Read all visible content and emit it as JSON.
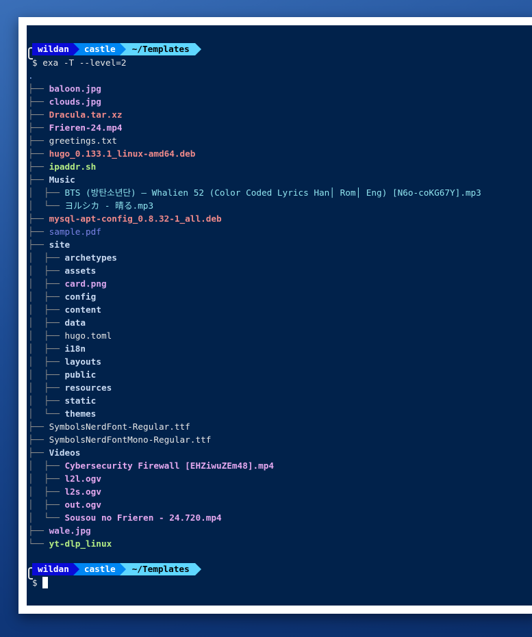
{
  "prompt": {
    "user": "wildan",
    "host": "castle",
    "dir": "~/Templates",
    "symbol": "$"
  },
  "command": "exa -T --level=2",
  "tree": [
    {
      "prefix": "",
      "name": ".",
      "type": "dot"
    },
    {
      "prefix": "├── ",
      "name": "baloon.jpg",
      "type": "img"
    },
    {
      "prefix": "├── ",
      "name": "clouds.jpg",
      "type": "img"
    },
    {
      "prefix": "├── ",
      "name": "Dracula.tar.xz",
      "type": "archive"
    },
    {
      "prefix": "├── ",
      "name": "Frieren-24.mp4",
      "type": "video"
    },
    {
      "prefix": "├── ",
      "name": "greetings.txt",
      "type": "plain"
    },
    {
      "prefix": "├── ",
      "name": "hugo_0.133.1_linux-amd64.deb",
      "type": "archive"
    },
    {
      "prefix": "├── ",
      "name": "ipaddr.sh",
      "type": "exec"
    },
    {
      "prefix": "├── ",
      "name": "Music",
      "type": "dir"
    },
    {
      "prefix": "│  ├── ",
      "name": "BTS (방탄소년단) – Whalien 52 (Color Coded Lyrics Han│ Rom│ Eng) [N6o-coKG67Y].mp3",
      "type": "audio"
    },
    {
      "prefix": "│  └── ",
      "name": "ヨルシカ - 晴る.mp3",
      "type": "audio"
    },
    {
      "prefix": "├── ",
      "name": "mysql-apt-config_0.8.32-1_all.deb",
      "type": "archive"
    },
    {
      "prefix": "├── ",
      "name": "sample.pdf",
      "type": "doc"
    },
    {
      "prefix": "├── ",
      "name": "site",
      "type": "dir"
    },
    {
      "prefix": "│  ├── ",
      "name": "archetypes",
      "type": "dir"
    },
    {
      "prefix": "│  ├── ",
      "name": "assets",
      "type": "dir"
    },
    {
      "prefix": "│  ├── ",
      "name": "card.png",
      "type": "img"
    },
    {
      "prefix": "│  ├── ",
      "name": "config",
      "type": "dir"
    },
    {
      "prefix": "│  ├── ",
      "name": "content",
      "type": "dir"
    },
    {
      "prefix": "│  ├── ",
      "name": "data",
      "type": "dir"
    },
    {
      "prefix": "│  ├── ",
      "name": "hugo.toml",
      "type": "plain"
    },
    {
      "prefix": "│  ├── ",
      "name": "i18n",
      "type": "dir"
    },
    {
      "prefix": "│  ├── ",
      "name": "layouts",
      "type": "dir"
    },
    {
      "prefix": "│  ├── ",
      "name": "public",
      "type": "dir"
    },
    {
      "prefix": "│  ├── ",
      "name": "resources",
      "type": "dir"
    },
    {
      "prefix": "│  ├── ",
      "name": "static",
      "type": "dir"
    },
    {
      "prefix": "│  └── ",
      "name": "themes",
      "type": "dir"
    },
    {
      "prefix": "├── ",
      "name": "SymbolsNerdFont-Regular.ttf",
      "type": "plain"
    },
    {
      "prefix": "├── ",
      "name": "SymbolsNerdFontMono-Regular.ttf",
      "type": "plain"
    },
    {
      "prefix": "├── ",
      "name": "Videos",
      "type": "dir"
    },
    {
      "prefix": "│  ├── ",
      "name": "Cybersecurity Firewall [EHZiwuZEm48].mp4",
      "type": "video"
    },
    {
      "prefix": "│  ├── ",
      "name": "l2l.ogv",
      "type": "video"
    },
    {
      "prefix": "│  ├── ",
      "name": "l2s.ogv",
      "type": "video"
    },
    {
      "prefix": "│  ├── ",
      "name": "out.ogv",
      "type": "video"
    },
    {
      "prefix": "│  └── ",
      "name": "Sousou no Frieren - 24.720.mp4",
      "type": "video"
    },
    {
      "prefix": "├── ",
      "name": "wale.jpg",
      "type": "img"
    },
    {
      "prefix": "└── ",
      "name": "yt-dlp_linux",
      "type": "exec"
    }
  ],
  "colors": {
    "background": "#01224b",
    "user_segment": "#0a0bd6",
    "host_segment": "#0087f2",
    "dir_segment": "#5fd7ff"
  }
}
